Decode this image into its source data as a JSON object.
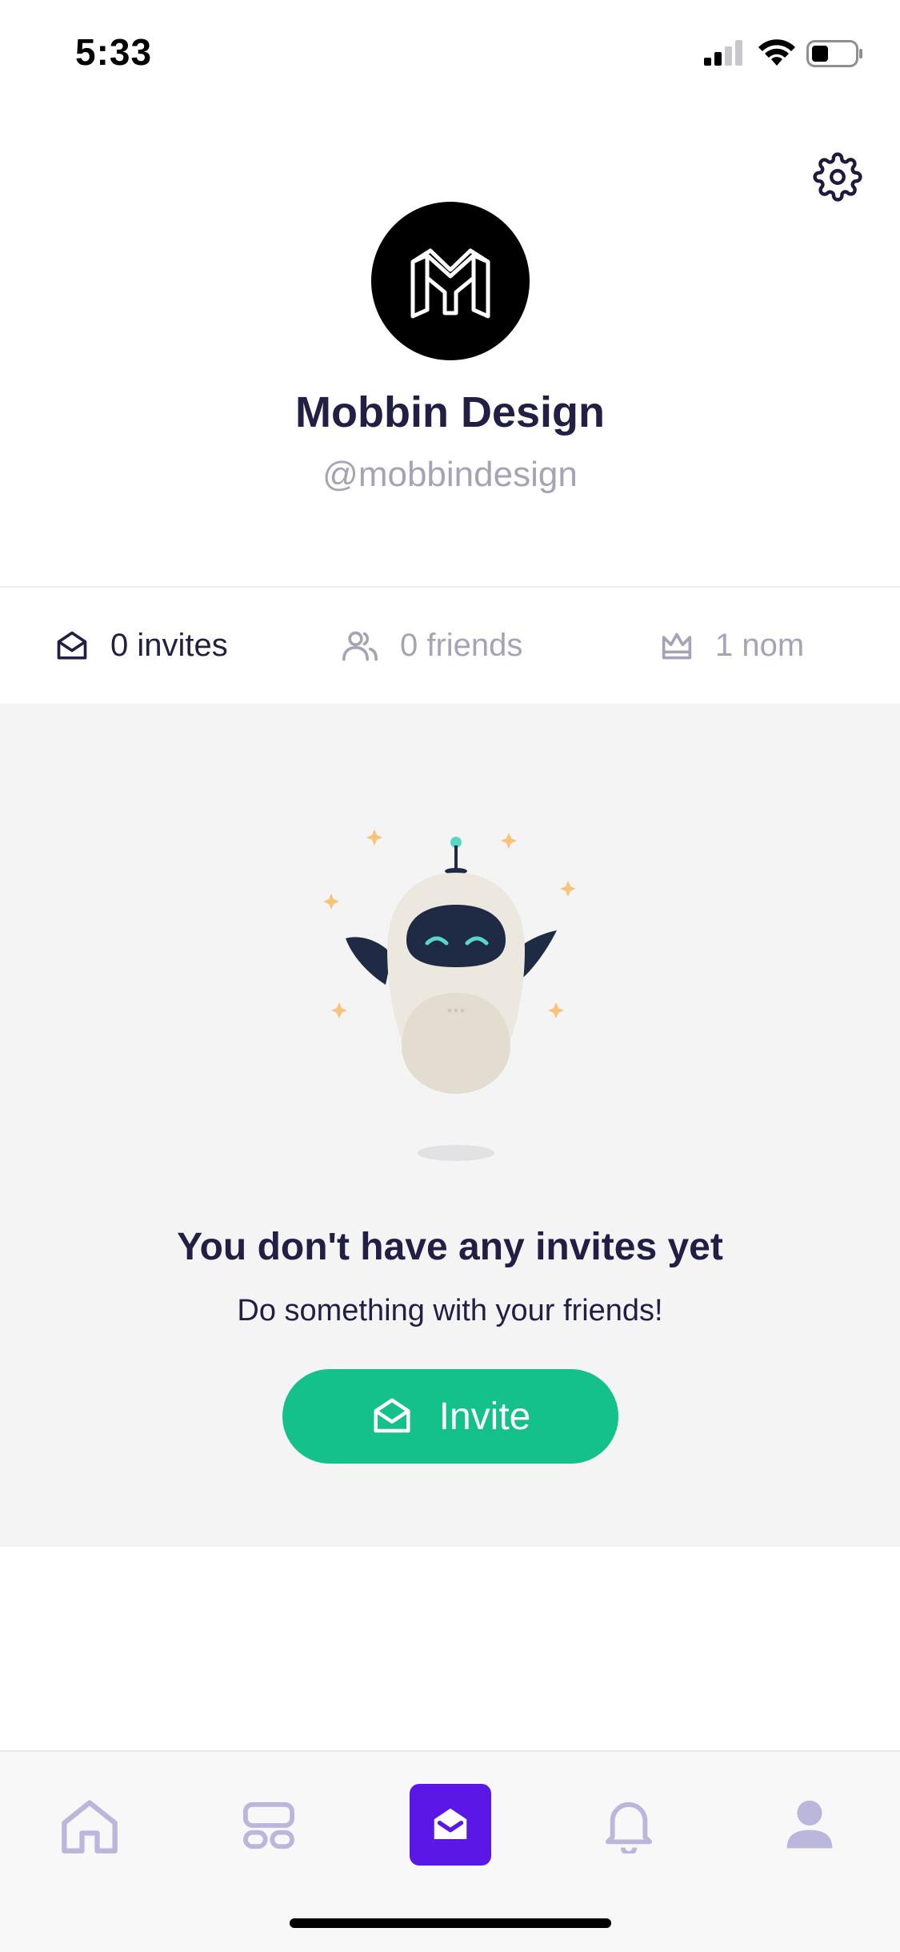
{
  "status_bar": {
    "time": "5:33"
  },
  "profile": {
    "name": "Mobbin Design",
    "handle": "@mobbindesign"
  },
  "stats": {
    "invites_label": "0 invites",
    "friends_label": "0 friends",
    "noms_label": "1 nom"
  },
  "empty_state": {
    "title": "You don't have any invites yet",
    "subtitle": "Do something with your friends!",
    "button_label": "Invite"
  },
  "icons": {
    "settings": "gear-icon",
    "invites": "envelope-icon",
    "friends": "people-icon",
    "noms": "crown-icon",
    "home": "home-icon",
    "feed": "grid-icon",
    "inbox": "envelope-icon",
    "notifications": "bell-icon",
    "profile": "user-icon"
  },
  "colors": {
    "accent": "#5b17e6",
    "invite_button": "#14c18b",
    "text_primary": "#221f45",
    "text_muted": "#a6a4b4",
    "panel_bg": "#f4f4f4"
  }
}
